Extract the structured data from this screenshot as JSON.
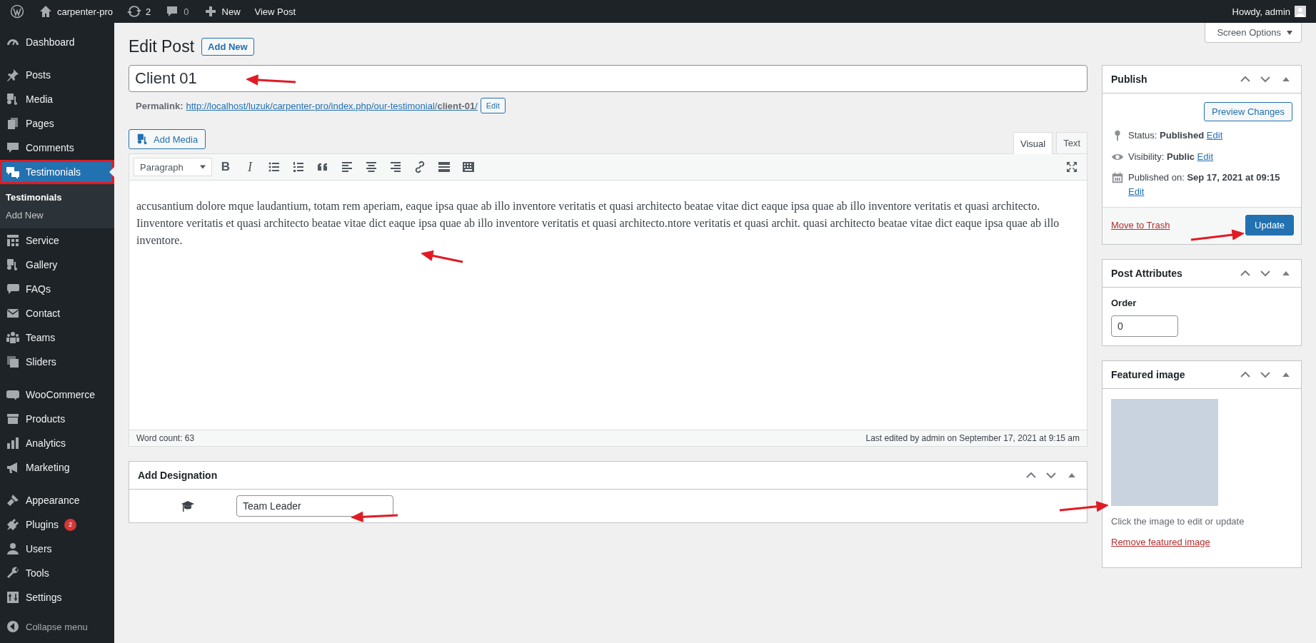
{
  "admin_bar": {
    "site_name": "carpenter-pro",
    "updates": "2",
    "comments": "0",
    "new_label": "New",
    "view_label": "View Post",
    "greeting": "Howdy, admin"
  },
  "sidebar": {
    "items": [
      {
        "label": "Dashboard",
        "selected": false,
        "group_start": false
      },
      {
        "label": "Posts",
        "selected": false,
        "group_start": true
      },
      {
        "label": "Media",
        "selected": false,
        "group_start": false
      },
      {
        "label": "Pages",
        "selected": false,
        "group_start": false
      },
      {
        "label": "Comments",
        "selected": false,
        "group_start": false
      },
      {
        "label": "Testimonials",
        "selected": true,
        "group_start": false,
        "children": [
          {
            "label": "Testimonials",
            "selected": true
          },
          {
            "label": "Add New",
            "selected": false
          }
        ]
      },
      {
        "label": "Service",
        "selected": false,
        "group_start": false
      },
      {
        "label": "Gallery",
        "selected": false,
        "group_start": false
      },
      {
        "label": "FAQs",
        "selected": false,
        "group_start": false
      },
      {
        "label": "Contact",
        "selected": false,
        "group_start": false
      },
      {
        "label": "Teams",
        "selected": false,
        "group_start": false
      },
      {
        "label": "Sliders",
        "selected": false,
        "group_start": false
      },
      {
        "label": "WooCommerce",
        "selected": false,
        "group_start": true
      },
      {
        "label": "Products",
        "selected": false,
        "group_start": false
      },
      {
        "label": "Analytics",
        "selected": false,
        "group_start": false
      },
      {
        "label": "Marketing",
        "selected": false,
        "group_start": false
      },
      {
        "label": "Appearance",
        "selected": false,
        "group_start": true
      },
      {
        "label": "Plugins",
        "selected": false,
        "group_start": false,
        "badge": "2"
      },
      {
        "label": "Users",
        "selected": false,
        "group_start": false
      },
      {
        "label": "Tools",
        "selected": false,
        "group_start": false
      },
      {
        "label": "Settings",
        "selected": false,
        "group_start": false
      }
    ],
    "collapse_label": "Collapse menu"
  },
  "screen_options": "Screen Options",
  "heading": "Edit Post",
  "add_new": "Add New",
  "post_title": "Client 01",
  "permalink": {
    "label": "Permalink:",
    "url": "http://localhost/luzuk/carpenter-pro/index.php/our-testimonial/**client-01**/",
    "edit": "Edit"
  },
  "editor": {
    "add_media": "Add Media",
    "tabs": [
      {
        "label": "Visual",
        "selected": true
      },
      {
        "label": "Text",
        "selected": false
      }
    ],
    "format": "Paragraph",
    "bold": "B",
    "italic": "I",
    "content": "accusantium dolore mque laudantium, totam rem aperiam, eaque ipsa quae ab illo inventore veritatis et quasi architecto beatae vitae dict eaque ipsa quae ab illo inventore veritatis et quasi architecto. Iinventore veritatis et quasi architecto beatae vitae dict eaque ipsa quae ab illo inventore veritatis et quasi architecto.ntore veritatis et quasi archit. quasi architecto beatae vitae dict eaque ipsa quae ab illo inventore.",
    "word_count": "Word count: 63",
    "last_edited": "Last edited by admin on September 17, 2021 at 9:15 am"
  },
  "designation": {
    "title": "Add Designation",
    "value": "Team Leader"
  },
  "publish": {
    "title": "Publish",
    "preview": "Preview Changes",
    "rows": [
      {
        "label": "Status:",
        "value": "Published",
        "edit": "Edit"
      },
      {
        "label": "Visibility:",
        "value": "Public",
        "edit": "Edit"
      },
      {
        "label": "Published on:",
        "value": "Sep 17, 2021 at 09:15",
        "edit": "Edit"
      }
    ],
    "trash": "Move to Trash",
    "update": "Update"
  },
  "attributes": {
    "title": "Post Attributes",
    "order_label": "Order",
    "order_value": "0"
  },
  "featured": {
    "title": "Featured image",
    "hint": "Click the image to edit or update",
    "remove": "Remove featured image"
  }
}
